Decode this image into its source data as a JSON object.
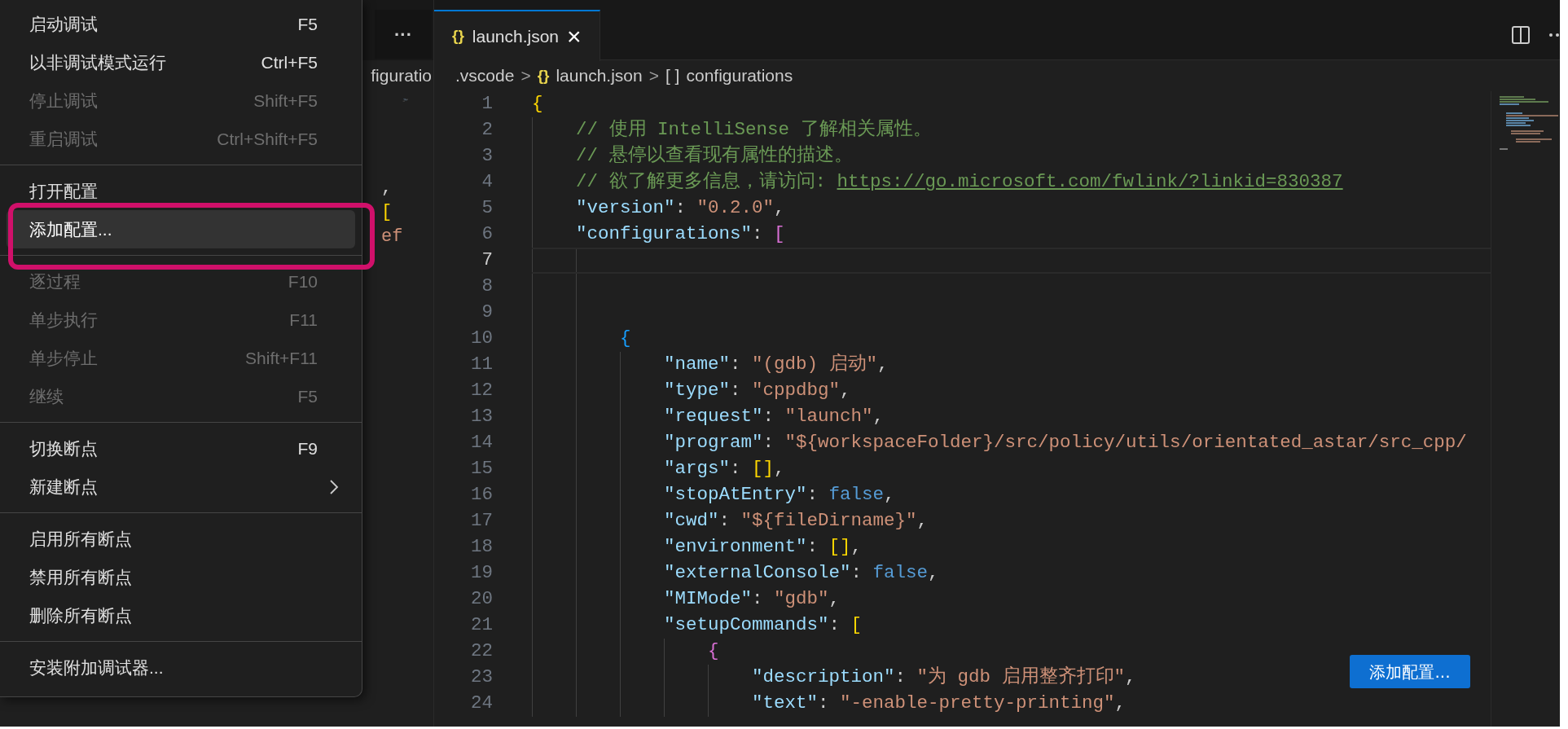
{
  "menu": {
    "groups": [
      {
        "items": [
          {
            "label": "启动调试",
            "shortcut": "F5",
            "disabled": false,
            "selected": false,
            "submenu": false
          },
          {
            "label": "以非调试模式运行",
            "shortcut": "Ctrl+F5",
            "disabled": false,
            "selected": false,
            "submenu": false
          },
          {
            "label": "停止调试",
            "shortcut": "Shift+F5",
            "disabled": true,
            "selected": false,
            "submenu": false
          },
          {
            "label": "重启调试",
            "shortcut": "Ctrl+Shift+F5",
            "disabled": true,
            "selected": false,
            "submenu": false
          }
        ]
      },
      {
        "items": [
          {
            "label": "打开配置",
            "disabled": false,
            "selected": false,
            "submenu": false
          },
          {
            "label": "添加配置...",
            "disabled": false,
            "selected": true,
            "submenu": false
          }
        ]
      },
      {
        "items": [
          {
            "label": "逐过程",
            "shortcut": "F10",
            "disabled": true,
            "selected": false,
            "submenu": false
          },
          {
            "label": "单步执行",
            "shortcut": "F11",
            "disabled": true,
            "selected": false,
            "submenu": false
          },
          {
            "label": "单步停止",
            "shortcut": "Shift+F11",
            "disabled": true,
            "selected": false,
            "submenu": false
          },
          {
            "label": "继续",
            "shortcut": "F5",
            "disabled": true,
            "selected": false,
            "submenu": false
          }
        ]
      },
      {
        "items": [
          {
            "label": "切换断点",
            "shortcut": "F9",
            "disabled": false,
            "selected": false,
            "submenu": false
          },
          {
            "label": "新建断点",
            "disabled": false,
            "selected": false,
            "submenu": true
          }
        ]
      },
      {
        "items": [
          {
            "label": "启用所有断点",
            "disabled": false,
            "selected": false,
            "submenu": false
          },
          {
            "label": "禁用所有断点",
            "disabled": false,
            "selected": false,
            "submenu": false
          },
          {
            "label": "删除所有断点",
            "disabled": false,
            "selected": false,
            "submenu": false
          }
        ]
      },
      {
        "items": [
          {
            "label": "安装附加调试器...",
            "disabled": false,
            "selected": false,
            "submenu": false
          }
        ]
      }
    ]
  },
  "side_pane": {
    "tab_overflow": "···",
    "breadcrumb": "figuratio",
    "code_fragments": [
      ",",
      "[",
      "ef"
    ]
  },
  "editor": {
    "tab": {
      "icon": "{}",
      "label": "launch.json",
      "close": "×",
      "selected": true
    },
    "breadcrumbs": [
      {
        "label": ".vscode"
      },
      {
        "icon": "{}",
        "label": "launch.json"
      },
      {
        "icon": "[ ]",
        "label": "configurations"
      }
    ],
    "breadcrumb_separator": ">",
    "lines": [
      {
        "number": "1",
        "current": false,
        "tokens": [
          {
            "kind": "bracket1",
            "text": "{"
          }
        ]
      },
      {
        "number": "2",
        "current": false,
        "tokens": [
          {
            "kind": "comment",
            "text": "    // 使用 IntelliSense 了解相关属性。"
          }
        ]
      },
      {
        "number": "3",
        "current": false,
        "tokens": [
          {
            "kind": "comment",
            "text": "    // 悬停以查看现有属性的描述。"
          }
        ]
      },
      {
        "number": "4",
        "current": false,
        "tokens": [
          {
            "kind": "comment",
            "text": "    // 欲了解更多信息，请访问: "
          },
          {
            "kind": "link",
            "text": "https://go.microsoft.com/fwlink/?linkid=830387"
          }
        ]
      },
      {
        "number": "5",
        "current": false,
        "tokens": [
          {
            "kind": "key",
            "text": "    \"version\""
          },
          {
            "kind": "punct",
            "text": ": "
          },
          {
            "kind": "string",
            "text": "\"0.2.0\""
          },
          {
            "kind": "punct",
            "text": ","
          }
        ]
      },
      {
        "number": "6",
        "current": false,
        "tokens": [
          {
            "kind": "key",
            "text": "    \"configurations\""
          },
          {
            "kind": "punct",
            "text": ": "
          },
          {
            "kind": "bracket2",
            "text": "["
          }
        ]
      },
      {
        "number": "7",
        "current": true
      },
      {
        "number": "8",
        "current": false
      },
      {
        "number": "9",
        "current": false
      },
      {
        "number": "10",
        "current": false,
        "tokens": [
          {
            "kind": "bracket3",
            "text": "        {"
          }
        ]
      },
      {
        "number": "11",
        "current": false,
        "tokens": [
          {
            "kind": "key",
            "text": "            \"name\""
          },
          {
            "kind": "punct",
            "text": ": "
          },
          {
            "kind": "string",
            "text": "\"(gdb) 启动\""
          },
          {
            "kind": "punct",
            "text": ","
          }
        ]
      },
      {
        "number": "12",
        "current": false,
        "tokens": [
          {
            "kind": "key",
            "text": "            \"type\""
          },
          {
            "kind": "punct",
            "text": ": "
          },
          {
            "kind": "string",
            "text": "\"cppdbg\""
          },
          {
            "kind": "punct",
            "text": ","
          }
        ]
      },
      {
        "number": "13",
        "current": false,
        "tokens": [
          {
            "kind": "key",
            "text": "            \"request\""
          },
          {
            "kind": "punct",
            "text": ": "
          },
          {
            "kind": "string",
            "text": "\"launch\""
          },
          {
            "kind": "punct",
            "text": ","
          }
        ]
      },
      {
        "number": "14",
        "current": false,
        "tokens": [
          {
            "kind": "key",
            "text": "            \"program\""
          },
          {
            "kind": "punct",
            "text": ": "
          },
          {
            "kind": "string",
            "text": "\"${workspaceFolder}/src/policy/utils/orientated_astar/src_cpp/"
          }
        ]
      },
      {
        "number": "15",
        "current": false,
        "tokens": [
          {
            "kind": "key",
            "text": "            \"args\""
          },
          {
            "kind": "punct",
            "text": ": "
          },
          {
            "kind": "bracket1",
            "text": "[]"
          },
          {
            "kind": "punct",
            "text": ","
          }
        ]
      },
      {
        "number": "16",
        "current": false,
        "tokens": [
          {
            "kind": "key",
            "text": "            \"stopAtEntry\""
          },
          {
            "kind": "punct",
            "text": ": "
          },
          {
            "kind": "bool",
            "text": "false"
          },
          {
            "kind": "punct",
            "text": ","
          }
        ]
      },
      {
        "number": "17",
        "current": false,
        "tokens": [
          {
            "kind": "key",
            "text": "            \"cwd\""
          },
          {
            "kind": "punct",
            "text": ": "
          },
          {
            "kind": "string",
            "text": "\"${fileDirname}\""
          },
          {
            "kind": "punct",
            "text": ","
          }
        ]
      },
      {
        "number": "18",
        "current": false,
        "tokens": [
          {
            "kind": "key",
            "text": "            \"environment\""
          },
          {
            "kind": "punct",
            "text": ": "
          },
          {
            "kind": "bracket1",
            "text": "[]"
          },
          {
            "kind": "punct",
            "text": ","
          }
        ]
      },
      {
        "number": "19",
        "current": false,
        "tokens": [
          {
            "kind": "key",
            "text": "            \"externalConsole\""
          },
          {
            "kind": "punct",
            "text": ": "
          },
          {
            "kind": "bool",
            "text": "false"
          },
          {
            "kind": "punct",
            "text": ","
          }
        ]
      },
      {
        "number": "20",
        "current": false,
        "tokens": [
          {
            "kind": "key",
            "text": "            \"MIMode\""
          },
          {
            "kind": "punct",
            "text": ": "
          },
          {
            "kind": "string",
            "text": "\"gdb\""
          },
          {
            "kind": "punct",
            "text": ","
          }
        ]
      },
      {
        "number": "21",
        "current": false,
        "tokens": [
          {
            "kind": "key",
            "text": "            \"setupCommands\""
          },
          {
            "kind": "punct",
            "text": ": "
          },
          {
            "kind": "bracket1",
            "text": "["
          }
        ]
      },
      {
        "number": "22",
        "current": false,
        "tokens": [
          {
            "kind": "bracket2",
            "text": "                {"
          }
        ]
      },
      {
        "number": "23",
        "current": false,
        "tokens": [
          {
            "kind": "key",
            "text": "                    \"description\""
          },
          {
            "kind": "punct",
            "text": ": "
          },
          {
            "kind": "string",
            "text": "\"为 gdb 启用整齐打印\""
          },
          {
            "kind": "punct",
            "text": ","
          }
        ]
      },
      {
        "number": "24",
        "current": false,
        "tokens": [
          {
            "kind": "key",
            "text": "                    \"text\""
          },
          {
            "kind": "punct",
            "text": ": "
          },
          {
            "kind": "string",
            "text": "\"-enable-pretty-printing\""
          },
          {
            "kind": "punct",
            "text": ","
          }
        ]
      }
    ],
    "add_config_button": "添加配置..."
  }
}
